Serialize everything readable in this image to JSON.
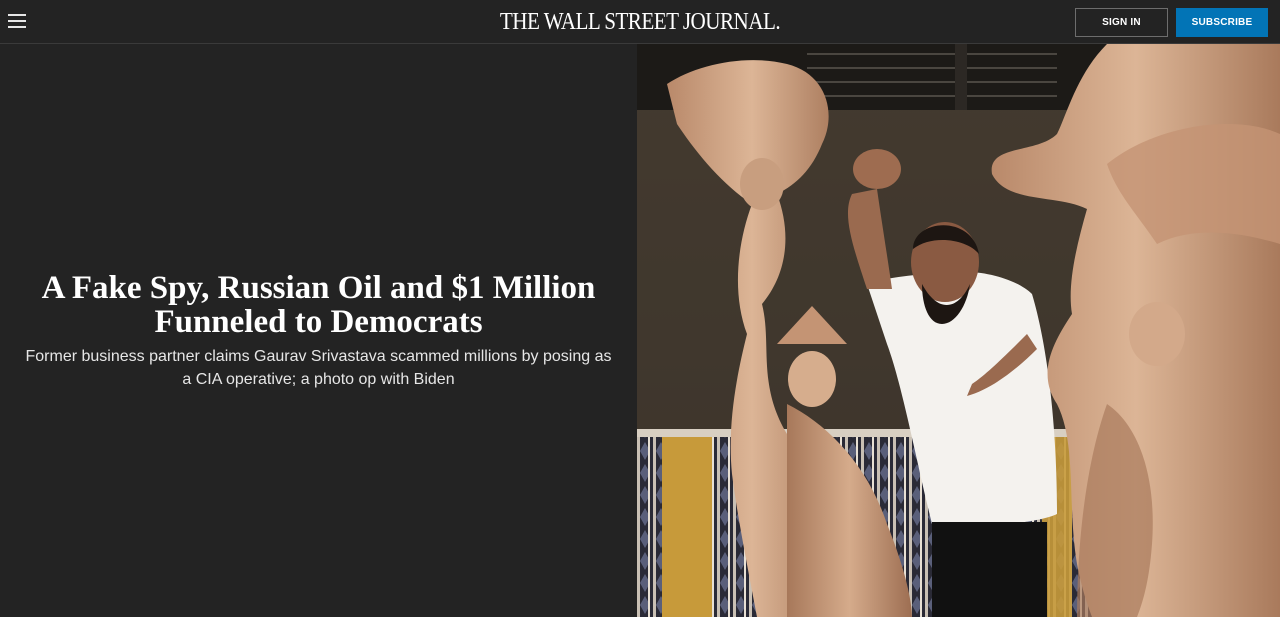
{
  "header": {
    "logo": "THE WALL STREET JOURNAL.",
    "menu_icon": "hamburger-menu-icon",
    "sign_in_label": "SIGN IN",
    "subscribe_label": "SUBSCRIBE"
  },
  "article": {
    "headline": "A Fake Spy, Russian Oil and $1 Million Funneled to Democrats",
    "dek": "Former business partner claims Gaurav Srivastava scammed millions by posing as a CIA operative; a photo op with Biden"
  },
  "colors": {
    "background": "#232323",
    "subscribe_button": "#0274b6",
    "text": "#ffffff"
  }
}
